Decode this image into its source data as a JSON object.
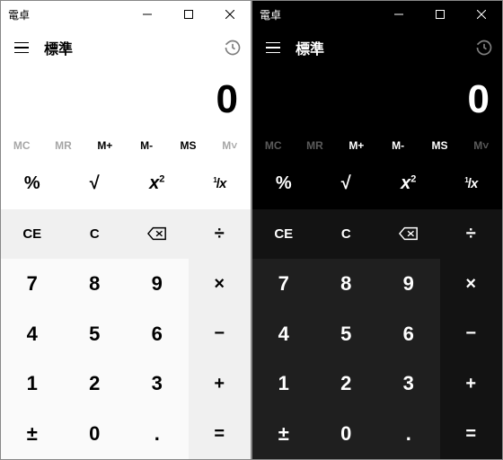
{
  "themes": [
    {
      "id": "light",
      "class": "light"
    },
    {
      "id": "dark",
      "class": "dark"
    }
  ],
  "titlebar": {
    "title": "電卓"
  },
  "header": {
    "mode": "標準"
  },
  "display": {
    "value": "0"
  },
  "memory": {
    "mc": "MC",
    "mr": "MR",
    "mplus": "M+",
    "mminus": "M-",
    "ms": "MS",
    "mlist": "M˅"
  },
  "funcRow": {
    "percent": "%",
    "sqrt": "√",
    "square_base": "x",
    "square_exp": "2",
    "recip_num": "1",
    "recip_sep": "/",
    "recip_den": "x"
  },
  "opRow": {
    "ce": "CE",
    "c": "C",
    "divide": "÷"
  },
  "nums": {
    "7": "7",
    "8": "8",
    "9": "9",
    "times": "×",
    "4": "4",
    "5": "5",
    "6": "6",
    "minus": "−",
    "1": "1",
    "2": "2",
    "3": "3",
    "plus": "+",
    "pm": "±",
    "0": "0",
    "dot": ".",
    "equals": "="
  }
}
